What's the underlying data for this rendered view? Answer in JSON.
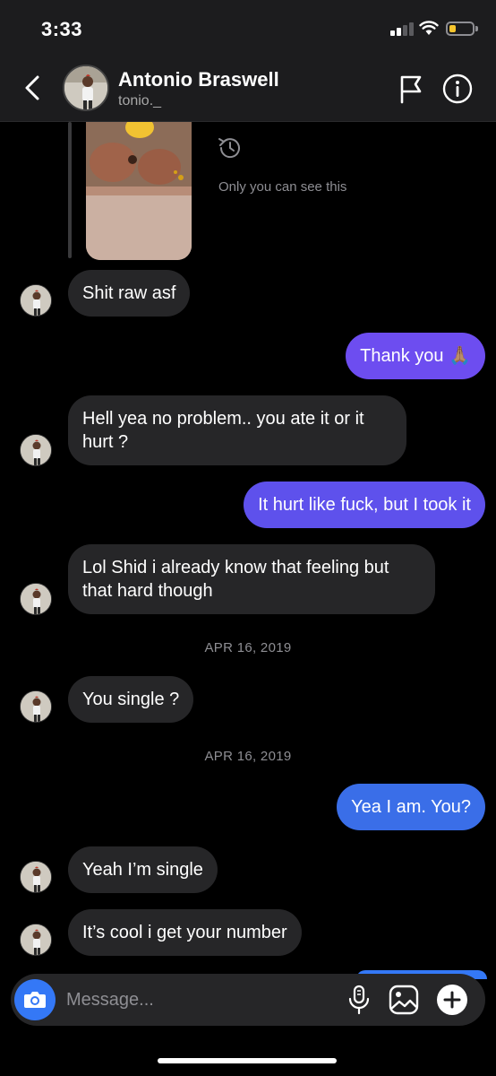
{
  "status": {
    "time": "3:33"
  },
  "header": {
    "name": "Antonio Braswell",
    "username": "tonio._"
  },
  "media": {
    "note": "Only you can see this"
  },
  "messages": [
    {
      "from": "them",
      "text": "Shit raw asf"
    },
    {
      "from": "me",
      "text": "Thank you 🙏🏽"
    },
    {
      "from": "them",
      "text": "Hell yea no problem.. you ate it or it hurt ?"
    },
    {
      "from": "me",
      "text": "It hurt like fuck, but I took it"
    },
    {
      "from": "them",
      "text": "Lol Shid i already know that feeling but that hard though"
    },
    {
      "from": "separator",
      "text": "APR 16, 2019"
    },
    {
      "from": "them",
      "text": "You single ?"
    },
    {
      "from": "separator",
      "text": "APR 16, 2019"
    },
    {
      "from": "me",
      "text": "Yea I am. You?"
    },
    {
      "from": "them",
      "text": "Yeah I’m single"
    },
    {
      "from": "them",
      "text": "It’s cool i get your number"
    }
  ],
  "composer": {
    "placeholder": "Message..."
  },
  "colors": {
    "sent_purple": "#6d4df0",
    "sent_blue": "#3a6ee8",
    "received": "#262628",
    "accent": "#3478f6"
  },
  "icons": [
    "back-chevron",
    "flag",
    "info",
    "history",
    "camera",
    "microphone",
    "gallery",
    "plus"
  ]
}
